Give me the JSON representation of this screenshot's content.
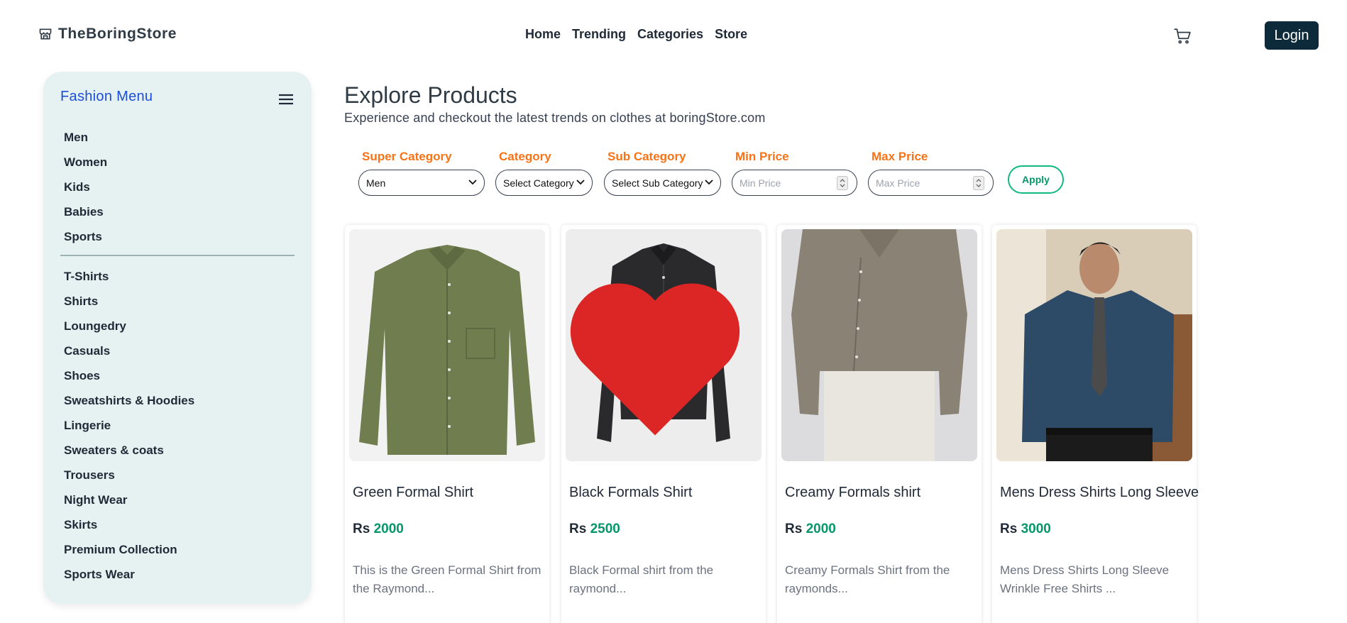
{
  "header": {
    "brand": "TheBoringStore",
    "nav": [
      "Home",
      "Trending",
      "Categories",
      "Store"
    ],
    "login_label": "Login"
  },
  "sidebar": {
    "title": "Fashion Menu",
    "group1": [
      "Men",
      "Women",
      "Kids",
      "Babies",
      "Sports"
    ],
    "group2": [
      "T-Shirts",
      "Shirts",
      "Loungedry",
      "Casuals",
      "Shoes",
      "Sweatshirts & Hoodies",
      "Lingerie",
      "Sweaters & coats",
      "Trousers",
      "Night Wear",
      "Skirts",
      "Premium Collection",
      "Sports Wear"
    ]
  },
  "main": {
    "title": "Explore Products",
    "subtitle": "Experience and checkout the latest trends on clothes at boringStore.com"
  },
  "filters": {
    "super_category": {
      "label": "Super Category",
      "value": "Men"
    },
    "category": {
      "label": "Category",
      "value": "Select Category"
    },
    "sub_category": {
      "label": "Sub Category",
      "value": "Select Sub Category"
    },
    "min_price": {
      "label": "Min Price",
      "placeholder": "Min Price"
    },
    "max_price": {
      "label": "Max Price",
      "placeholder": "Max Price"
    },
    "apply_label": "Apply"
  },
  "products": [
    {
      "title": "Green Formal Shirt",
      "currency": "Rs",
      "price": "2000",
      "description": "This is the Green Formal Shirt from the Raymond...",
      "favorited": false
    },
    {
      "title": "Black Formals Shirt",
      "currency": "Rs",
      "price": "2500",
      "description": "Black Formal shirt from the raymond...",
      "favorited": true
    },
    {
      "title": "Creamy Formals shirt",
      "currency": "Rs",
      "price": "2000",
      "description": "Creamy Formals Shirt from the raymonds...",
      "favorited": false
    },
    {
      "title": "Mens Dress Shirts Long Sleeve",
      "currency": "Rs",
      "price": "3000",
      "description": "Mens Dress Shirts Long Sleeve Wrinkle Free Shirts ...",
      "favorited": false
    }
  ],
  "icons": {
    "brand": "store-icon",
    "cart": "cart-icon",
    "menu": "hamburger-icon",
    "favorite": "heart-icon"
  },
  "colors": {
    "accent_orange": "#f97316",
    "price_green": "#059669",
    "login_bg": "#0c2a3a",
    "sidebar_bg": "#e6f1f1",
    "menu_title": "#1d4ed8",
    "heart": "#dc2626"
  }
}
